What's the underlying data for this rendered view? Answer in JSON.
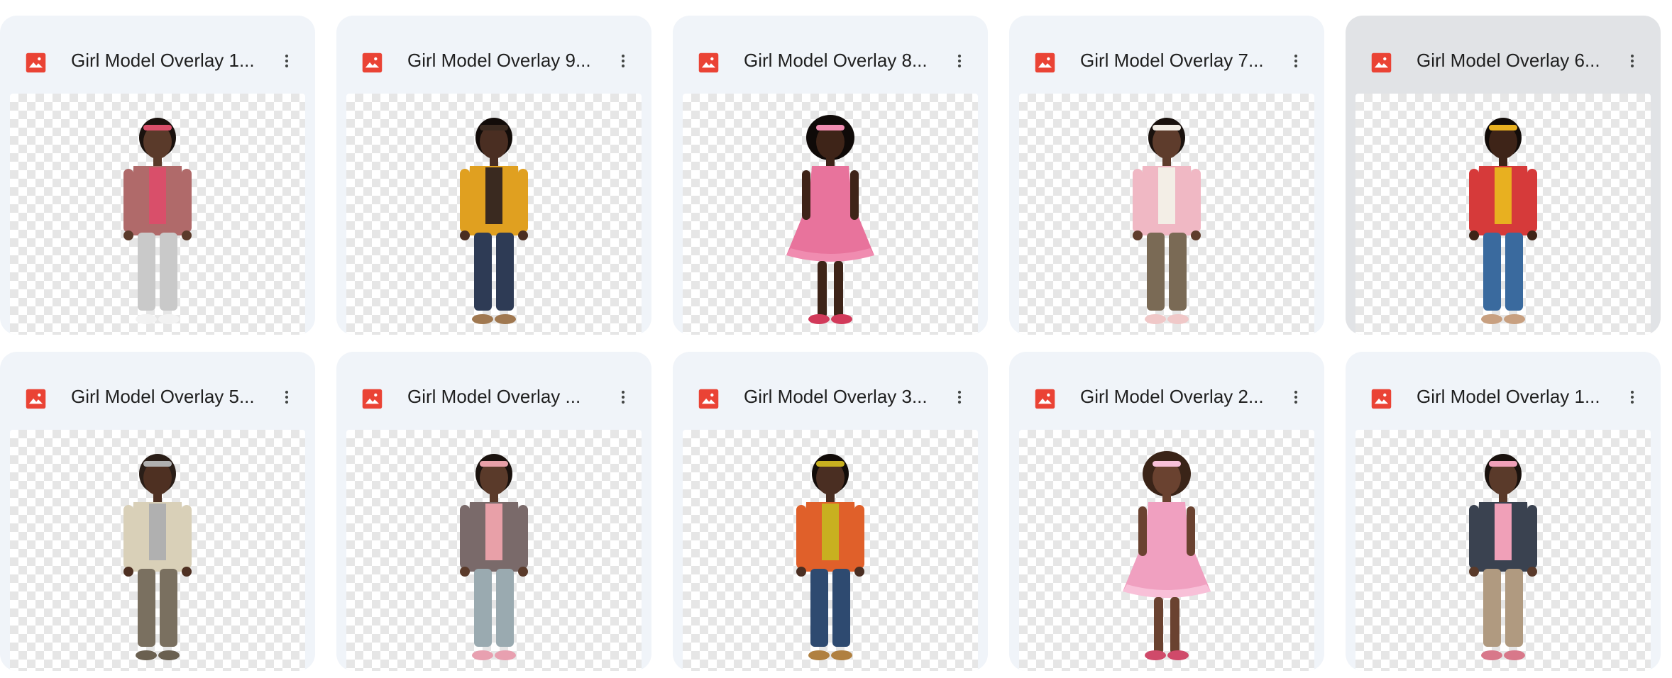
{
  "files": [
    {
      "title": "Girl Model Overlay 1...",
      "selected": false,
      "icon": "image-file-icon",
      "skin": "#5a3a2a",
      "hair": "#1a120e",
      "top": "#b06a6a",
      "bottom": "#c9c9c9",
      "accent": "#d94f6a",
      "shoes": "#f2f2f2"
    },
    {
      "title": "Girl Model Overlay 9...",
      "selected": false,
      "icon": "image-file-icon",
      "skin": "#4a2e22",
      "hair": "#120c09",
      "top": "#e0a020",
      "bottom": "#2e3b55",
      "accent": "#3a2a20",
      "shoes": "#a07850"
    },
    {
      "title": "Girl Model Overlay 8...",
      "selected": false,
      "icon": "image-file-icon",
      "skin": "#3e2418",
      "hair": "#0f0a08",
      "top": "#e8739c",
      "bottom": "#e8739c",
      "accent": "#f08cb0",
      "shoes": "#d23a5a"
    },
    {
      "title": "Girl Model Overlay 7...",
      "selected": false,
      "icon": "image-file-icon",
      "skin": "#5e3c2c",
      "hair": "#1a120e",
      "top": "#f0b8c4",
      "bottom": "#7a6a55",
      "accent": "#f3eee6",
      "shoes": "#f0c8c8"
    },
    {
      "title": "Girl Model Overlay 6...",
      "selected": true,
      "icon": "image-file-icon",
      "skin": "#3e2418",
      "hair": "#120c09",
      "top": "#d63a3a",
      "bottom": "#3a6a9e",
      "accent": "#e8b020",
      "shoes": "#c8a080"
    },
    {
      "title": "Girl Model Overlay 5...",
      "selected": false,
      "icon": "image-file-icon",
      "skin": "#4e3022",
      "hair": "#2a1e18",
      "top": "#d9d0b8",
      "bottom": "#7a7060",
      "accent": "#b0b0b0",
      "shoes": "#6a6050"
    },
    {
      "title": "Girl Model Overlay ...",
      "selected": false,
      "icon": "image-file-icon",
      "skin": "#5a3a2a",
      "hair": "#1a120e",
      "top": "#7a6a6a",
      "bottom": "#9aaab0",
      "accent": "#e8a0a8",
      "shoes": "#e8a0b0"
    },
    {
      "title": "Girl Model Overlay 3...",
      "selected": false,
      "icon": "image-file-icon",
      "skin": "#4a2e22",
      "hair": "#120c09",
      "top": "#e0602a",
      "bottom": "#2e4a70",
      "accent": "#c8b020",
      "shoes": "#b08040"
    },
    {
      "title": "Girl Model Overlay 2...",
      "selected": false,
      "icon": "image-file-icon",
      "skin": "#6a4230",
      "hair": "#3a2418",
      "top": "#f0a0c0",
      "bottom": "#f0a0c0",
      "accent": "#f8c0d8",
      "shoes": "#d04a6a"
    },
    {
      "title": "Girl Model Overlay 1...",
      "selected": false,
      "icon": "image-file-icon",
      "skin": "#5a3a2a",
      "hair": "#1a120e",
      "top": "#3a4250",
      "bottom": "#b09a80",
      "accent": "#f0a0b8",
      "shoes": "#d8788a"
    }
  ],
  "colors": {
    "icon_red": "#ea4335",
    "menu_dots": "#444746"
  }
}
